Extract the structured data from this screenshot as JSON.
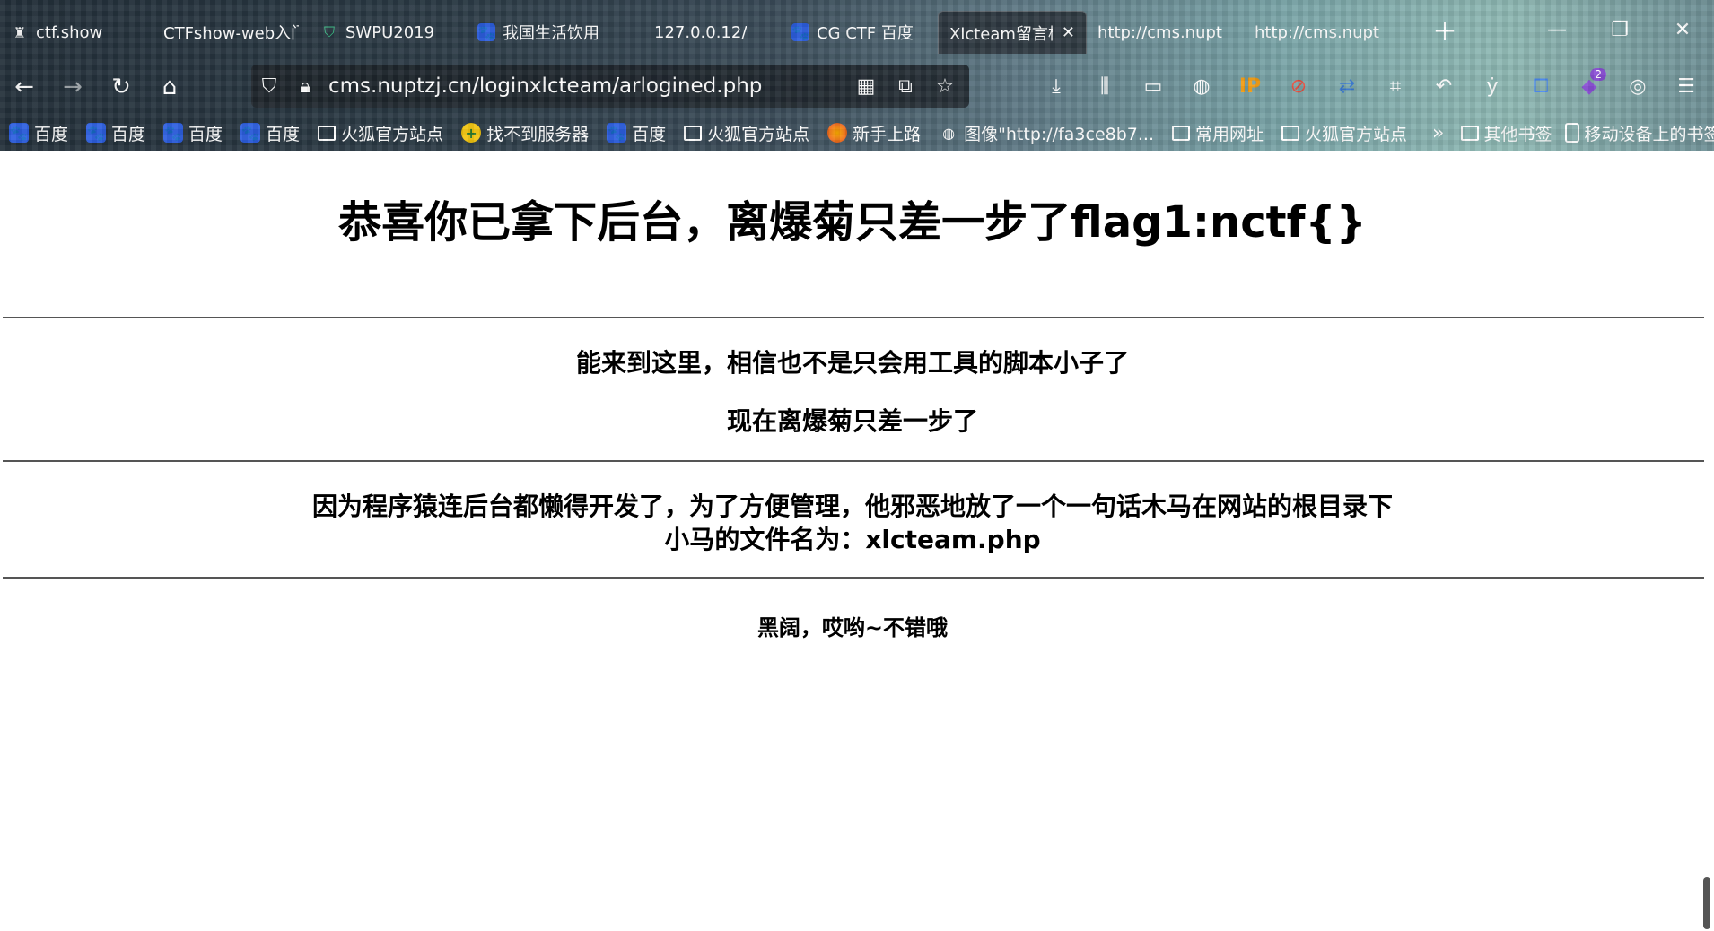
{
  "tabs": [
    {
      "label": "ctf.show",
      "icon": "ctfshow-icon",
      "active": false
    },
    {
      "label": "CTFshow-web入门",
      "icon": "",
      "active": false
    },
    {
      "label": "SWPU2019",
      "icon": "shield-icon",
      "active": false
    },
    {
      "label": "我国生活饮用",
      "icon": "baidu-icon",
      "active": false
    },
    {
      "label": "127.0.0.12/",
      "icon": "",
      "active": false
    },
    {
      "label": "CG CTF 百度",
      "icon": "baidu-icon",
      "active": false
    },
    {
      "label": "Xlcteam留言板",
      "icon": "",
      "active": true
    },
    {
      "label": "http://cms.nupt",
      "icon": "",
      "active": false
    },
    {
      "label": "http://cms.nupt",
      "icon": "",
      "active": false
    }
  ],
  "navbar": {
    "url": "cms.nuptzj.cn/loginxlcteam/arlogined.php"
  },
  "toolbar": {
    "ext_badge": "2"
  },
  "bookmarks": [
    {
      "label": "百度",
      "type": "paw"
    },
    {
      "label": "百度",
      "type": "paw"
    },
    {
      "label": "百度",
      "type": "paw"
    },
    {
      "label": "百度",
      "type": "paw"
    },
    {
      "label": "火狐官方站点",
      "type": "folder"
    },
    {
      "label": "找不到服务器",
      "type": "plus"
    },
    {
      "label": "百度",
      "type": "paw"
    },
    {
      "label": "火狐官方站点",
      "type": "folder"
    },
    {
      "label": "新手上路",
      "type": "firefox"
    },
    {
      "label": "图像\"http://fa3ce8b7...",
      "type": "globe"
    },
    {
      "label": "常用网址",
      "type": "folder"
    },
    {
      "label": "火狐官方站点",
      "type": "folder"
    }
  ],
  "bookmarks_right": [
    {
      "label": "其他书签",
      "type": "folder"
    },
    {
      "label": "移动设备上的书签",
      "type": "phone"
    }
  ],
  "page": {
    "heading": "恭喜你已拿下后台，离爆菊只差一步了flag1:nctf{}",
    "line1": "能来到这里，相信也不是只会用工具的脚本小子了",
    "line2": "现在离爆菊只差一步了",
    "line3": "因为程序猿连后台都懒得开发了，为了方便管理，他邪恶地放了一个一句话木马在网站的根目录下",
    "line4": "小马的文件名为：xlcteam.php",
    "line5": "黑阔，哎哟~不错哦"
  }
}
